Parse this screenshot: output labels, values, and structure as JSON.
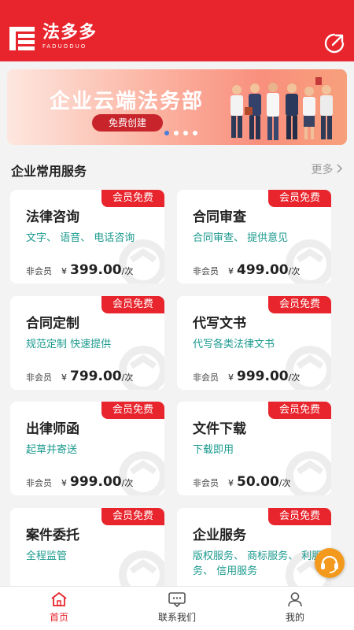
{
  "header": {
    "logo_cn": "法多多",
    "logo_en": "FADUODUO",
    "share_icon": "share-icon",
    "color": "#e8242c"
  },
  "banner": {
    "title": "企业云端法务部",
    "cta": "免费创建",
    "slide_count": 4,
    "active_slide": 0
  },
  "section": {
    "title": "企业常用服务",
    "more": "更多"
  },
  "cards": [
    {
      "badge": "会员免费",
      "title": "法律咨询",
      "desc": "文字、 语音、 电话咨询",
      "nonmember": "非会员",
      "yen": "¥",
      "price": "399.00",
      "unit": "/次"
    },
    {
      "badge": "会员免费",
      "title": "合同审查",
      "desc": "合同审查、 提供意见",
      "nonmember": "非会员",
      "yen": "¥",
      "price": "499.00",
      "unit": "/次"
    },
    {
      "badge": "会员免费",
      "title": "合同定制",
      "desc": "规范定制 快速提供",
      "nonmember": "非会员",
      "yen": "¥",
      "price": "799.00",
      "unit": "/次"
    },
    {
      "badge": "会员免费",
      "title": "代写文书",
      "desc": "代写各类法律文书",
      "nonmember": "非会员",
      "yen": "¥",
      "price": "999.00",
      "unit": "/次"
    },
    {
      "badge": "会员免费",
      "title": "出律师函",
      "desc": "起草并寄送",
      "nonmember": "非会员",
      "yen": "¥",
      "price": "999.00",
      "unit": "/次"
    },
    {
      "badge": "会员免费",
      "title": "文件下载",
      "desc": "下载即用",
      "nonmember": "非会员",
      "yen": "¥",
      "price": "50.00",
      "unit": "/次"
    },
    {
      "badge": "会员免费",
      "title": "案件委托",
      "desc": "全程监管"
    },
    {
      "badge": "会员免费",
      "title": "企业服务",
      "desc": "版权服务、 商标服务、 利服务、 信用服务"
    }
  ],
  "tabbar": {
    "items": [
      {
        "label": "首页",
        "icon": "home-icon",
        "active": true
      },
      {
        "label": "联系我们",
        "icon": "chat-icon",
        "active": false
      },
      {
        "label": "我的",
        "icon": "user-icon",
        "active": false
      }
    ],
    "active_color": "#e8242c"
  },
  "floating": {
    "icon": "customer-service-icon",
    "color": "#f39a1e"
  }
}
